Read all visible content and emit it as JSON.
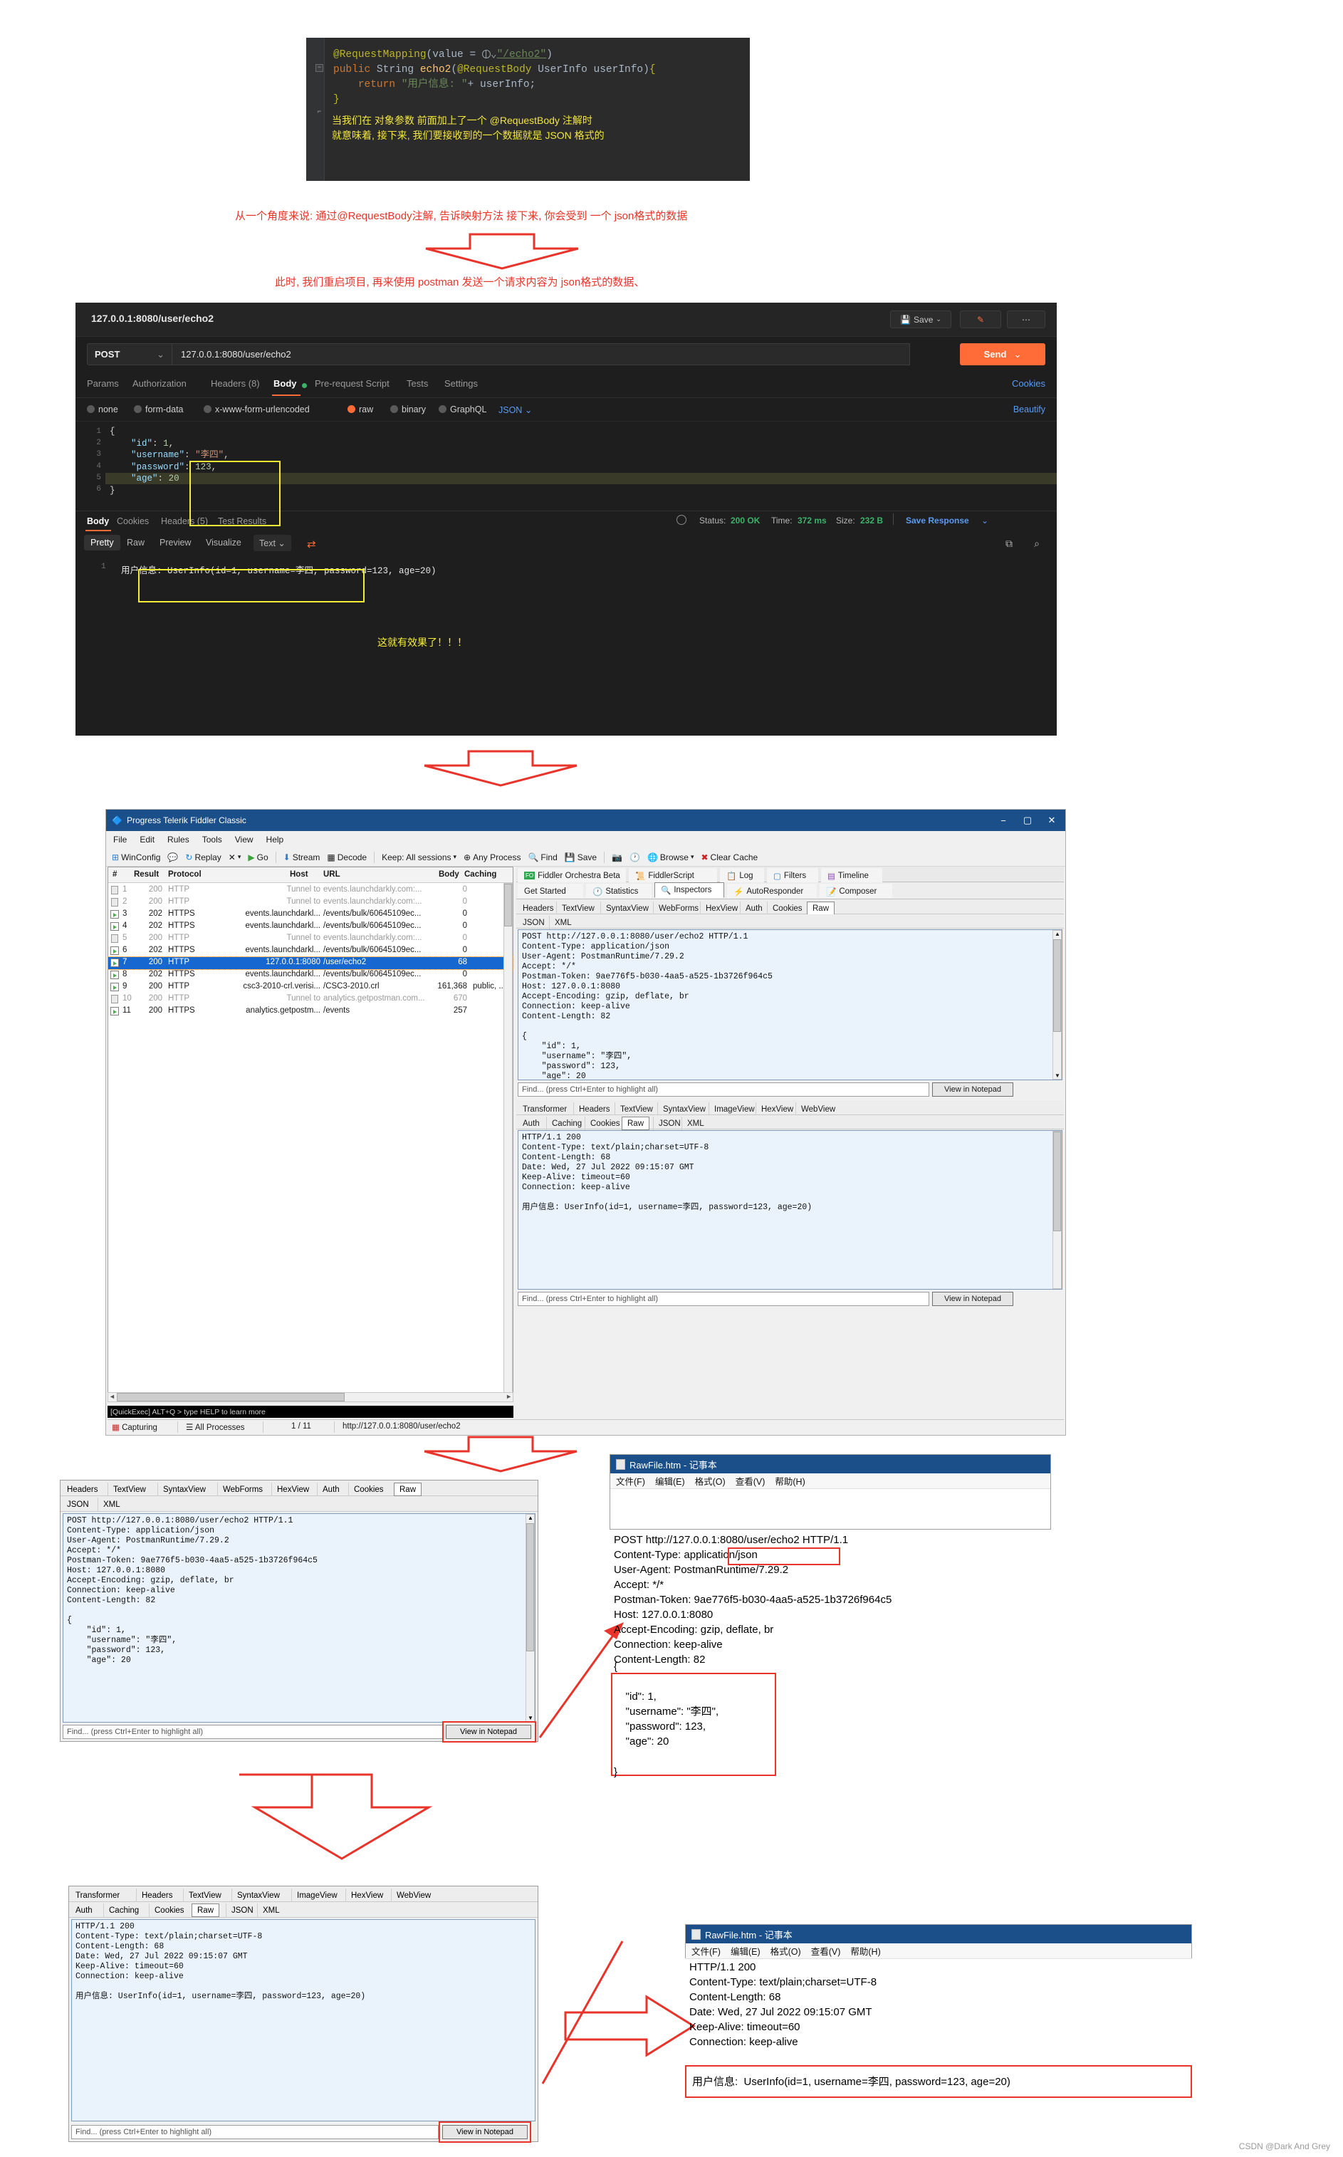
{
  "ide": {
    "line1_anno": "@RequestMapping",
    "line1_rest": "(value = ",
    "line1_path": "\"/echo2\"",
    "line1_close": ")",
    "line2": "public String echo2(@RequestBody UserInfo userInfo){",
    "line3": "return \"用户信息: \"+ userInfo;",
    "line4": "}",
    "note1": "当我们在 对象参数 前面加上了一个 @RequestBody 注解时",
    "note2": "就意味着, 接下来, 我们要接收到的一个数据就是 JSON 格式的"
  },
  "annotations": {
    "red1": "从一个角度来说: 通过@RequestBody注解, 告诉映射方法 接下来, 你会受到 一个  json格式的数据",
    "red2": "此时, 我们重启项目, 再来使用 postman 发送一个请求内容为  json格式的数据、",
    "yellow_effect": "这就有效果了！！！"
  },
  "postman": {
    "tab_title": "127.0.0.1:8080/user/echo2",
    "save_label": "Save",
    "method": "POST",
    "url": "127.0.0.1:8080/user/echo2",
    "send_label": "Send",
    "cookies_label": "Cookies",
    "beautify_label": "Beautify",
    "request_tabs": [
      {
        "label": "Params",
        "active": false
      },
      {
        "label": "Authorization",
        "active": false
      },
      {
        "label": "Headers (8)",
        "active": false
      },
      {
        "label": "Body",
        "active": true
      },
      {
        "label": "Pre-request Script",
        "active": false
      },
      {
        "label": "Tests",
        "active": false
      },
      {
        "label": "Settings",
        "active": false
      }
    ],
    "body_options": [
      {
        "label": "none",
        "selected": false
      },
      {
        "label": "form-data",
        "selected": false
      },
      {
        "label": "x-www-form-urlencoded",
        "selected": false
      },
      {
        "label": "raw",
        "selected": true
      },
      {
        "label": "binary",
        "selected": false
      },
      {
        "label": "GraphQL",
        "selected": false
      }
    ],
    "raw_format": "JSON",
    "editor_lines": [
      "1",
      "2",
      "3",
      "4",
      "5",
      "6"
    ],
    "editor_body": "{\n    \"id\": 1,\n    \"username\": \"李四\",\n    \"password\": 123,\n    \"age\": 20\n}",
    "response_tabs": [
      {
        "label": "Body",
        "active": true
      },
      {
        "label": "Cookies",
        "active": false
      },
      {
        "label": "Headers (5)",
        "active": false
      },
      {
        "label": "Test Results",
        "active": false
      }
    ],
    "view_tabs": [
      {
        "label": "Pretty",
        "active": true
      },
      {
        "label": "Raw",
        "active": false
      },
      {
        "label": "Preview",
        "active": false
      },
      {
        "label": "Visualize",
        "active": false
      }
    ],
    "format_select": "Text",
    "status_label": "Status:",
    "status_value": "200 OK",
    "time_label": "Time:",
    "time_value": "372 ms",
    "size_label": "Size:",
    "size_value": "232 B",
    "save_response_label": "Save Response",
    "output_line_no": "1",
    "output_text": "用户信息: UserInfo(id=1, username=李四, password=123, age=20)"
  },
  "fiddler": {
    "title": "Progress Telerik Fiddler Classic",
    "menus": [
      "File",
      "Edit",
      "Rules",
      "Tools",
      "View",
      "Help"
    ],
    "toolbar": [
      "WinConfig",
      "Replay",
      "X",
      "Go",
      "Stream",
      "Decode",
      "Keep: All sessions",
      "Any Process",
      "Find",
      "Save",
      "Browse",
      "Clear Cache"
    ],
    "columns": [
      "#",
      "Result",
      "Protocol",
      "Host",
      "URL",
      "Body",
      "Caching"
    ],
    "sessions": [
      {
        "id": "1",
        "result": "200",
        "protocol": "HTTP",
        "host": "Tunnel to",
        "url": "events.launchdarkly.com:...",
        "body": "0",
        "caching": "",
        "icon": "lock",
        "dim": true,
        "selected": false
      },
      {
        "id": "2",
        "result": "200",
        "protocol": "HTTP",
        "host": "Tunnel to",
        "url": "events.launchdarkly.com:...",
        "body": "0",
        "caching": "",
        "icon": "lock",
        "dim": true,
        "selected": false
      },
      {
        "id": "3",
        "result": "202",
        "protocol": "HTTPS",
        "host": "events.launchdarkl...",
        "url": "/events/bulk/60645109ec...",
        "body": "0",
        "caching": "",
        "icon": "arrow",
        "dim": false,
        "selected": false
      },
      {
        "id": "4",
        "result": "202",
        "protocol": "HTTPS",
        "host": "events.launchdarkl...",
        "url": "/events/bulk/60645109ec...",
        "body": "0",
        "caching": "",
        "icon": "arrow",
        "dim": false,
        "selected": false
      },
      {
        "id": "5",
        "result": "200",
        "protocol": "HTTP",
        "host": "Tunnel to",
        "url": "events.launchdarkly.com:...",
        "body": "0",
        "caching": "",
        "icon": "lock",
        "dim": true,
        "selected": false
      },
      {
        "id": "6",
        "result": "202",
        "protocol": "HTTPS",
        "host": "events.launchdarkl...",
        "url": "/events/bulk/60645109ec...",
        "body": "0",
        "caching": "",
        "icon": "arrow",
        "dim": false,
        "selected": false
      },
      {
        "id": "7",
        "result": "200",
        "protocol": "HTTP",
        "host": "127.0.0.1:8080",
        "url": "/user/echo2",
        "body": "68",
        "caching": "",
        "icon": "arrow",
        "dim": false,
        "selected": true
      },
      {
        "id": "8",
        "result": "202",
        "protocol": "HTTPS",
        "host": "events.launchdarkl...",
        "url": "/events/bulk/60645109ec...",
        "body": "0",
        "caching": "",
        "icon": "arrow",
        "dim": false,
        "selected": false
      },
      {
        "id": "9",
        "result": "200",
        "protocol": "HTTP",
        "host": "csc3-2010-crl.verisi...",
        "url": "/CSC3-2010.crl",
        "body": "161,368",
        "caching": "public, ..",
        "icon": "doc",
        "dim": false,
        "selected": false
      },
      {
        "id": "10",
        "result": "200",
        "protocol": "HTTP",
        "host": "Tunnel to",
        "url": "analytics.getpostman.com...",
        "body": "670",
        "caching": "",
        "icon": "lock",
        "dim": true,
        "selected": false
      },
      {
        "id": "11",
        "result": "200",
        "protocol": "HTTPS",
        "host": "analytics.getpostm...",
        "url": "/events",
        "body": "257",
        "caching": "",
        "icon": "arrow",
        "dim": false,
        "selected": false
      }
    ],
    "app_tabs_row1": [
      "Fiddler Orchestra Beta",
      "FiddlerScript",
      "Log",
      "Filters",
      "Timeline"
    ],
    "app_tabs_row2": [
      "Get Started",
      "Statistics",
      "Inspectors",
      "AutoResponder",
      "Composer"
    ],
    "inspector_tabs_row1": [
      "Headers",
      "TextView",
      "SyntaxView",
      "WebForms",
      "HexView",
      "Auth",
      "Cookies",
      "Raw"
    ],
    "inspector_tabs_row2": [
      "JSON",
      "XML"
    ],
    "request_raw": "POST http://127.0.0.1:8080/user/echo2 HTTP/1.1\nContent-Type: application/json\nUser-Agent: PostmanRuntime/7.29.2\nAccept: */*\nPostman-Token: 9ae776f5-b030-4aa5-a525-1b3726f964c5\nHost: 127.0.0.1:8080\nAccept-Encoding: gzip, deflate, br\nConnection: keep-alive\nContent-Length: 82\n\n{\n    \"id\": 1,\n    \"username\": \"李四\",\n    \"password\": 123,\n    \"age\": 20",
    "response_tabs_row1": [
      "Transformer",
      "Headers",
      "TextView",
      "SyntaxView",
      "ImageView",
      "HexView",
      "WebView"
    ],
    "response_tabs_row2": [
      "Auth",
      "Caching",
      "Cookies",
      "Raw",
      "JSON",
      "XML"
    ],
    "response_raw": "HTTP/1.1 200\nContent-Type: text/plain;charset=UTF-8\nContent-Length: 68\nDate: Wed, 27 Jul 2022 09:15:07 GMT\nKeep-Alive: timeout=60\nConnection: keep-alive\n\n用户信息: UserInfo(id=1, username=李四, password=123, age=20)",
    "find_placeholder": "Find... (press Ctrl+Enter to highlight all)",
    "view_notepad": "View in Notepad",
    "quickexec": "[QuickExec] ALT+Q > type HELP to learn more",
    "status_capturing": "Capturing",
    "status_processes": "All Processes",
    "status_count": "1 / 11",
    "status_url": "http://127.0.0.1:8080/user/echo2"
  },
  "notepad_request": {
    "title": "RawFile.htm - 记事本",
    "menus": [
      "文件(F)",
      "编辑(E)",
      "格式(O)",
      "查看(V)",
      "帮助(H)"
    ],
    "line_post": "POST http://127.0.0.1:8080/user/echo2 HTTP/1.1",
    "line_ct_label": "Content-Type:",
    "line_ct_value": "application/json",
    "body_rest": "User-Agent: PostmanRuntime/7.29.2\nAccept: */*\nPostman-Token: 9ae776f5-b030-4aa5-a525-1b3726f964c5\nHost: 127.0.0.1:8080\nAccept-Encoding: gzip, deflate, br\nConnection: keep-alive\nContent-Length: 82",
    "json_open": "{",
    "json_body": "    \"id\": 1,\n    \"username\": \"李四\",\n    \"password\": 123,\n    \"age\": 20",
    "json_close": "}"
  },
  "notepad_response": {
    "title": "RawFile.htm - 记事本",
    "menus": [
      "文件(F)",
      "编辑(E)",
      "格式(O)",
      "查看(V)",
      "帮助(H)"
    ],
    "headers": "HTTP/1.1 200\nContent-Type: text/plain;charset=UTF-8\nContent-Length: 68\nDate: Wed, 27 Jul 2022 09:15:07 GMT\nKeep-Alive: timeout=60\nConnection: keep-alive",
    "highlighted": "用户信息:  UserInfo(id=1, username=李四, password=123, age=20)"
  },
  "watermark": "CSDN @Dark And Grey",
  "colors": {
    "accent_orange": "#ff6c37",
    "red": "#e8342a",
    "yellow": "#f5ee36",
    "fiddler_blue": "#1b4f8a",
    "green": "#3db26a"
  }
}
